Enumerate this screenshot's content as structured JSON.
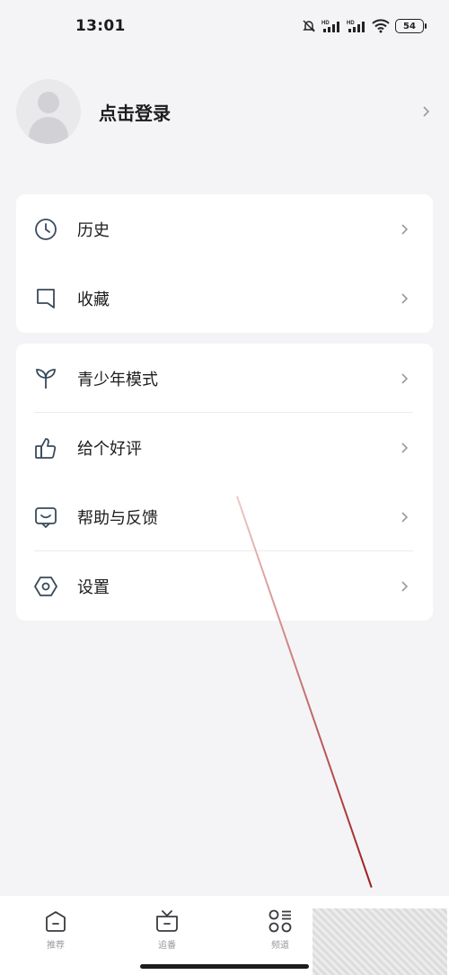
{
  "status": {
    "time": "13:01",
    "battery": "54",
    "signal_tag_1": "HD",
    "signal_tag_2": "HD"
  },
  "profile": {
    "login_label": "点击登录"
  },
  "menu_group_1": [
    {
      "label": "历史",
      "icon": "clock-icon"
    },
    {
      "label": "收藏",
      "icon": "bookmark-icon"
    }
  ],
  "menu_group_2": [
    {
      "label": "青少年模式",
      "icon": "sprout-icon"
    },
    {
      "label": "给个好评",
      "icon": "thumbs-up-icon"
    },
    {
      "label": "帮助与反馈",
      "icon": "chat-icon"
    },
    {
      "label": "设置",
      "icon": "gear-icon"
    }
  ],
  "tabbar": {
    "tabs": [
      {
        "label": "推荐",
        "icon": "home-icon"
      },
      {
        "label": "追番",
        "icon": "tv-icon"
      },
      {
        "label": "频道",
        "icon": "grid-icon"
      }
    ]
  },
  "colors": {
    "background": "#f4f4f6",
    "card": "#ffffff",
    "icon_stroke": "#3a4a5a"
  }
}
